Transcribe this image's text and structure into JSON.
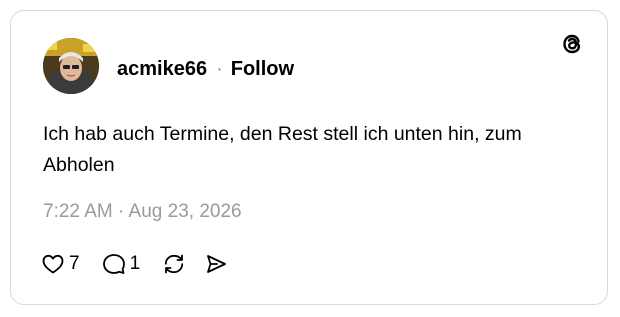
{
  "post": {
    "username": "acmike66",
    "separator": "·",
    "follow_label": "Follow",
    "text": "Ich hab auch Termine, den Rest stell ich unten hin, zum Abholen",
    "timestamp": "7:22 AM · Aug 23, 2026"
  },
  "actions": {
    "likes": "7",
    "replies": "1"
  },
  "icons": {
    "logo": "threads-logo-icon",
    "like": "heart-icon",
    "reply": "comment-bubble-icon",
    "repost": "repost-icon",
    "share": "send-icon"
  },
  "colors": {
    "text": "#000000",
    "muted": "#9a9a9a",
    "border": "#d9d9d9",
    "background": "#ffffff"
  }
}
